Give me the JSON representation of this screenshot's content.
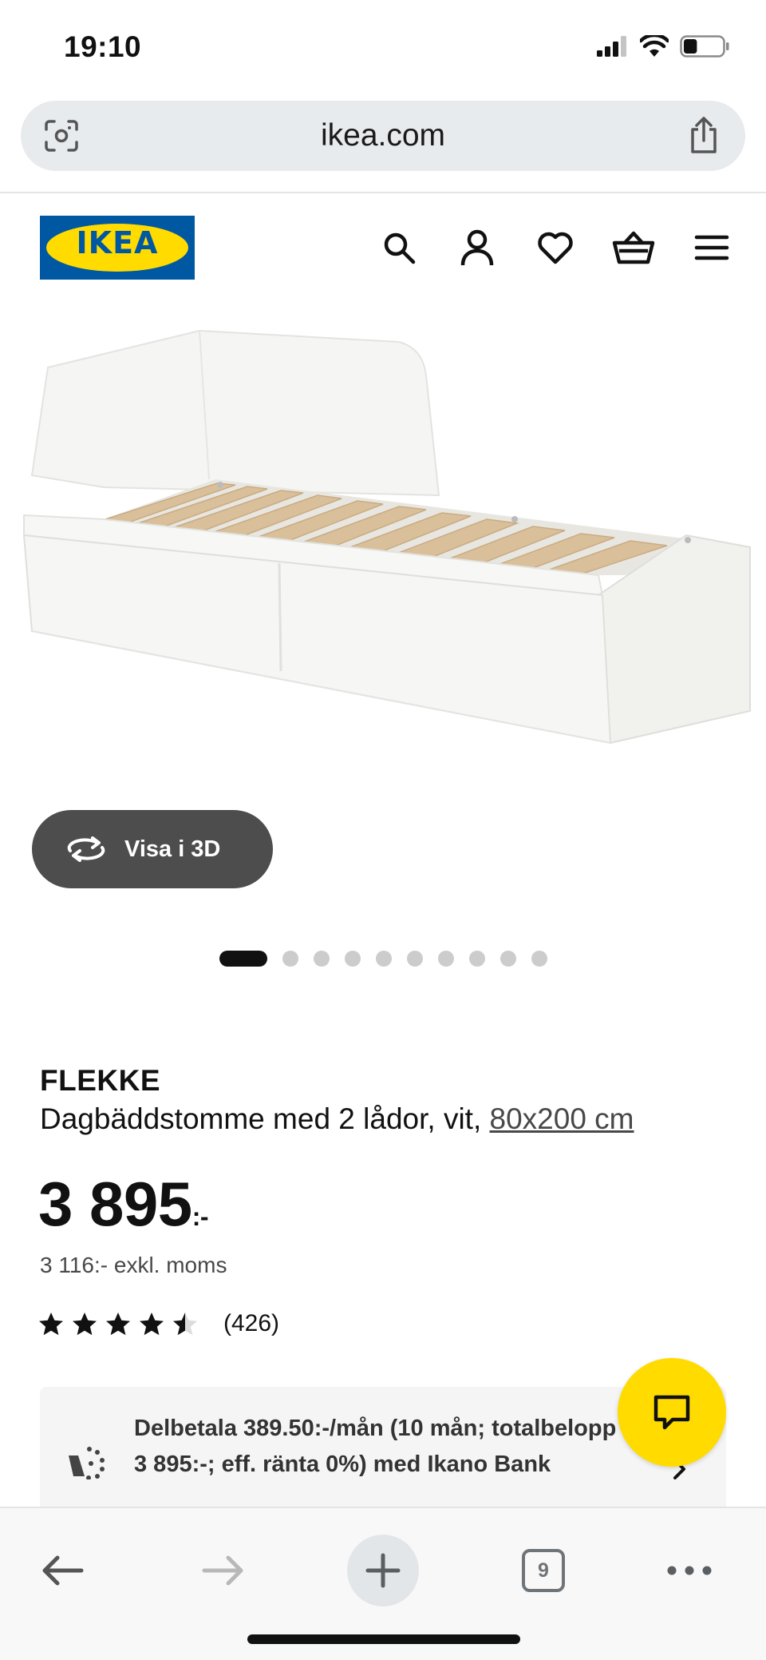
{
  "status_bar": {
    "time": "19:10",
    "battery_percent": 35
  },
  "browser": {
    "url": "ikea.com",
    "open_tabs": "9"
  },
  "header": {
    "logo_text": "IKEA",
    "brand_blue": "#0058a3",
    "brand_yellow": "#ffdb00"
  },
  "gallery": {
    "view_3d_label": "Visa i 3D",
    "dot_count": 10,
    "active_index": 0
  },
  "product": {
    "name": "FLEKKE",
    "description": "Dagbäddstomme med 2 lådor, vit, ",
    "size": "80x200 cm",
    "price": "3 895",
    "price_suffix": ":-",
    "price_ex_vat": "3 116:- exkl. moms",
    "rating": 4.5,
    "review_count": "(426)"
  },
  "finance": {
    "text": "Delbetala 389.50:-/mån (10 mån; totalbelopp 3 895:-; eff. ränta 0%) med Ikano Bank"
  },
  "icons": [
    "signal-icon",
    "wifi-icon",
    "battery-icon",
    "camera-search-icon",
    "share-icon",
    "search-icon",
    "user-icon",
    "heart-icon",
    "basket-icon",
    "menu-icon",
    "rotate-3d-icon",
    "star-icon",
    "installment-icon",
    "chevron-right-icon",
    "chat-icon",
    "back-icon",
    "forward-icon",
    "plus-icon",
    "tabs-icon",
    "more-icon"
  ]
}
